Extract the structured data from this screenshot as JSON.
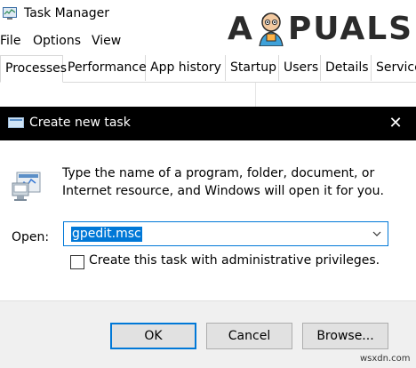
{
  "task_manager": {
    "title": "Task Manager",
    "logo_left": "A",
    "logo_right": "PUALS",
    "menu": [
      "File",
      "Options",
      "View"
    ],
    "tabs": [
      "Processes",
      "Performance",
      "App history",
      "Startup",
      "Users",
      "Details",
      "Service"
    ],
    "active_tab": "Processes"
  },
  "dialog": {
    "title": "Create new task",
    "close_glyph": "✕",
    "description_line1": "Type the name of a program, folder, document, or",
    "description_line2": "Internet resource, and Windows will open it for you.",
    "open_label": "Open:",
    "open_value": "gpedit.msc",
    "admin_checkbox_label": "Create this task with administrative privileges.",
    "admin_checked": false,
    "buttons": {
      "ok": "OK",
      "cancel": "Cancel",
      "browse": "Browse..."
    }
  },
  "watermark": "wsxdn.com",
  "colors": {
    "accent": "#0078d7",
    "dialog_titlebar": "#000000",
    "footer_bg": "#f0f0f0",
    "button_bg": "#e1e1e1"
  },
  "icons": {
    "tm_app": "task-manager-icon",
    "dialog": "run-dialog-icon",
    "run": "run-program-icon",
    "dropdown": "chevron-down-icon",
    "close": "close-icon"
  }
}
